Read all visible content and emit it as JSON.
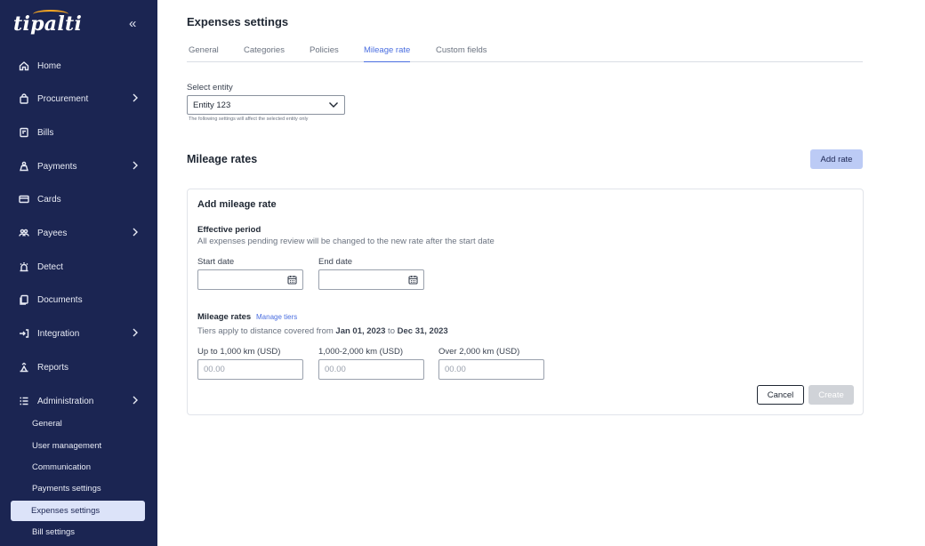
{
  "app": {
    "logo_text": "tipalti",
    "collapse_glyph": "«"
  },
  "sidebar": {
    "items": [
      {
        "label": "Home",
        "icon": "home-icon",
        "has_chevron": false
      },
      {
        "label": "Procurement",
        "icon": "bag-icon",
        "has_chevron": true
      },
      {
        "label": "Bills",
        "icon": "bill-icon",
        "has_chevron": false
      },
      {
        "label": "Payments",
        "icon": "payments-icon",
        "has_chevron": true
      },
      {
        "label": "Cards",
        "icon": "card-icon",
        "has_chevron": false
      },
      {
        "label": "Payees",
        "icon": "payees-icon",
        "has_chevron": true
      },
      {
        "label": "Detect",
        "icon": "detect-icon",
        "has_chevron": false
      },
      {
        "label": "Documents",
        "icon": "documents-icon",
        "has_chevron": false
      },
      {
        "label": "Integration",
        "icon": "integration-icon",
        "has_chevron": true
      },
      {
        "label": "Reports",
        "icon": "reports-icon",
        "has_chevron": false
      },
      {
        "label": "Administration",
        "icon": "administration-icon",
        "has_chevron": true
      }
    ],
    "sub_items": [
      {
        "label": "General",
        "active": false
      },
      {
        "label": "User management",
        "active": false
      },
      {
        "label": "Communication",
        "active": false
      },
      {
        "label": "Payments settings",
        "active": false
      },
      {
        "label": "Expenses settings",
        "active": true
      },
      {
        "label": "Bill settings",
        "active": false
      }
    ]
  },
  "main": {
    "title": "Expenses settings",
    "tabs": [
      {
        "label": "General",
        "active": false
      },
      {
        "label": "Categories",
        "active": false
      },
      {
        "label": "Policies",
        "active": false
      },
      {
        "label": "Mileage rate",
        "active": true
      },
      {
        "label": "Custom fields",
        "active": false
      }
    ],
    "entity": {
      "label": "Select entity",
      "value": "Entity 123",
      "hint": "The following settings will affect the selected entity only"
    },
    "section_title": "Mileage rates",
    "add_rate_label": "Add rate"
  },
  "card": {
    "title": "Add mileage rate",
    "effective_period": {
      "title": "Effective period",
      "description": "All expenses pending review will be changed to the new rate after the start date",
      "start_label": "Start date",
      "end_label": "End date"
    },
    "rates": {
      "title": "Mileage rates",
      "manage_link": "Manage tiers",
      "desc_prefix": "Tiers apply to distance covered from ",
      "date_from": "Jan 01, 2023",
      "desc_mid": " to ",
      "date_to": "Dec 31, 2023",
      "tiers": [
        {
          "label": "Up to 1,000 km (USD)",
          "placeholder": "00.00"
        },
        {
          "label": "1,000-2,000 km (USD)",
          "placeholder": "00.00"
        },
        {
          "label": "Over 2,000 km (USD)",
          "placeholder": "00.00"
        }
      ]
    },
    "cancel_label": "Cancel",
    "create_label": "Create"
  },
  "colors": {
    "sidebar_bg": "#1b2552",
    "accent": "#4a6ee0",
    "primary_button": "#bccbf5",
    "active_sub_item": "#dce3f9",
    "logo_arc": "#f5a623"
  }
}
